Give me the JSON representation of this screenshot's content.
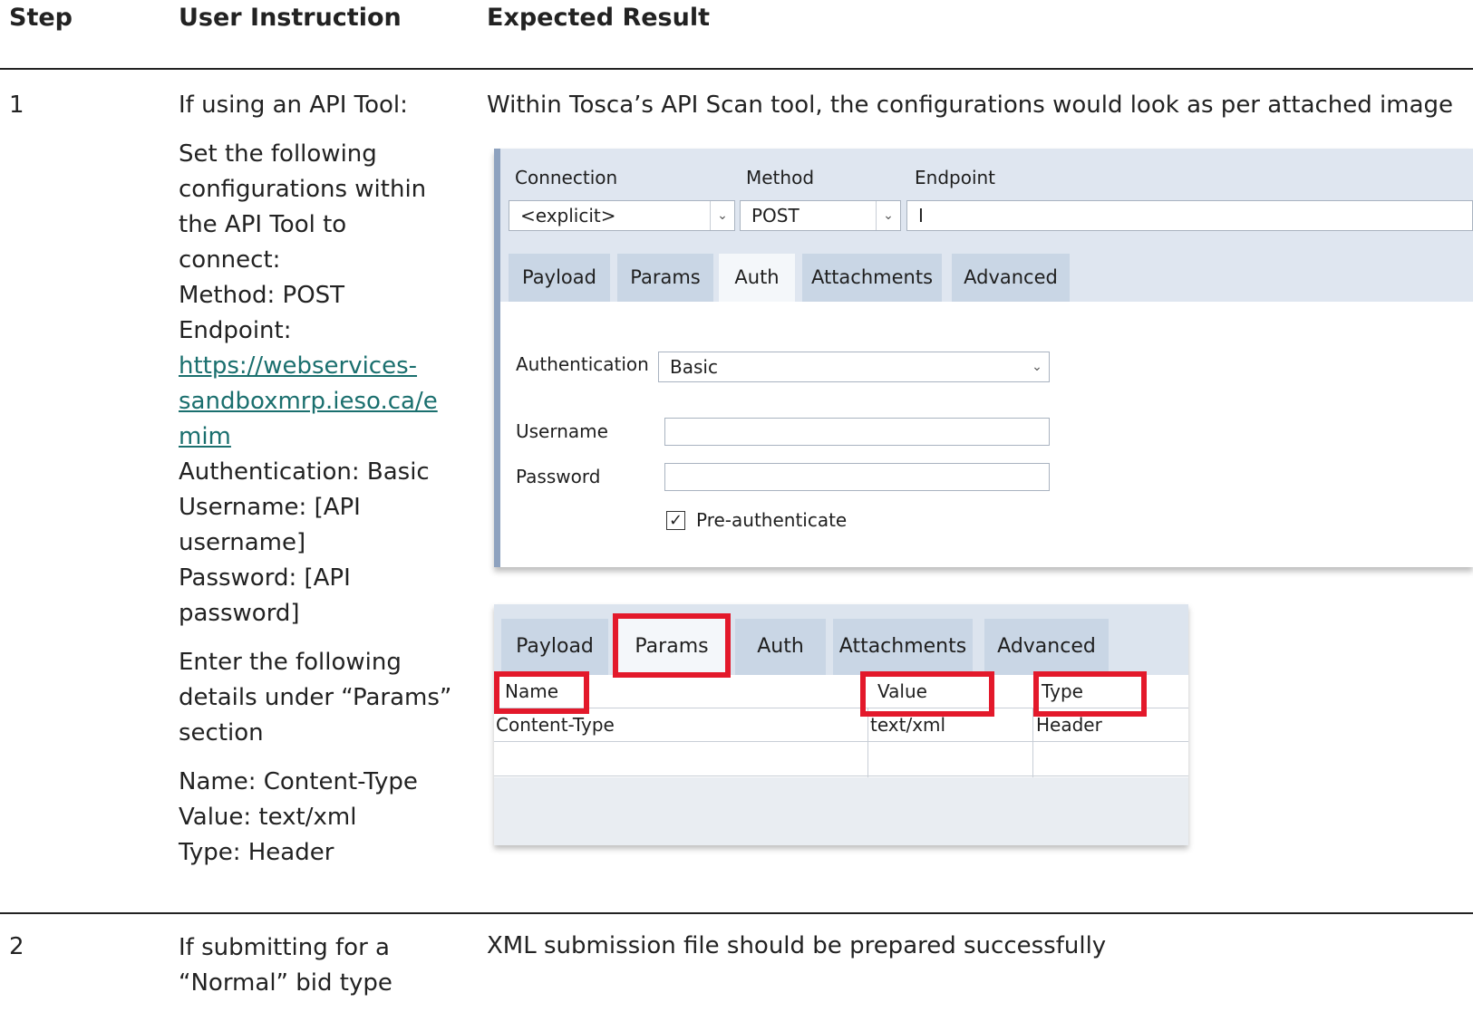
{
  "headers": {
    "step": "Step",
    "instruction": "User Instruction",
    "result": "Expected Result"
  },
  "rows": [
    {
      "step": "1",
      "instruction_lines": [
        "If using an API Tool:",
        "Set the following",
        "configurations within",
        "the API Tool to",
        "connect:",
        "Method: POST",
        "Endpoint:",
        "https://webservices-",
        "sandboxmrp.ieso.ca/e",
        "mim",
        "Authentication: Basic",
        "Username: [API",
        "username]",
        "Password: [API",
        "password]",
        "Enter the following",
        "details under “Params”",
        "section",
        "Name: Content-Type",
        "Value: text/xml",
        "Type: Header"
      ],
      "result": "Within Tosca’s API Scan tool, the configurations would look as per attached image"
    },
    {
      "step": "2",
      "instruction_lines": [
        "If submitting for a",
        "“Normal” bid type"
      ],
      "result": "XML submission file should be prepared successfully"
    }
  ],
  "screenshot1": {
    "connection_label": "Connection",
    "method_label": "Method",
    "endpoint_label": "Endpoint",
    "connection_value": "<explicit>",
    "method_value": "POST",
    "endpoint_value": "I",
    "tabs": [
      "Payload",
      "Params",
      "Auth",
      "Attachments",
      "Advanced"
    ],
    "active_tab": "Auth",
    "authentication_label": "Authentication",
    "authentication_value": "Basic",
    "username_label": "Username",
    "password_label": "Password",
    "preauth_label": "Pre-authenticate",
    "preauth_checked": true
  },
  "screenshot2": {
    "tabs": [
      "Payload",
      "Params",
      "Auth",
      "Attachments",
      "Advanced"
    ],
    "active_tab": "Params",
    "columns": [
      "Name",
      "Value",
      "Type"
    ],
    "rows": [
      [
        "Content-Type",
        "text/xml",
        "Header"
      ]
    ],
    "highlight_color": "#e3192b"
  }
}
